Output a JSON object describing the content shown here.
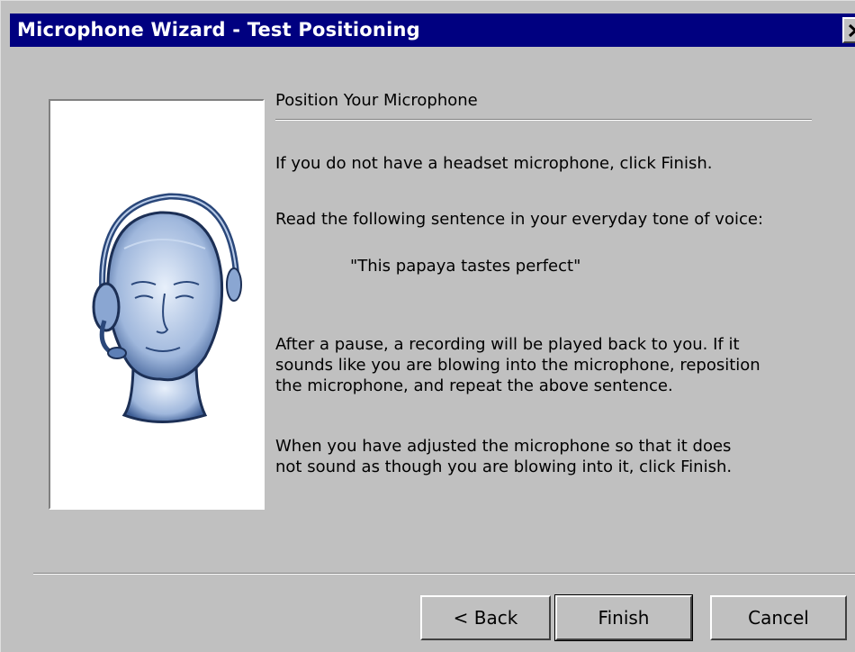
{
  "window": {
    "title": "Microphone Wizard - Test Positioning",
    "title_bar_color": "#000080",
    "close_icon": "close-icon"
  },
  "illustration": {
    "icon": "headset-head-illustration"
  },
  "content": {
    "heading": "Position Your Microphone",
    "line1": "If you do not have a headset microphone, click Finish.",
    "line2": "Read the following sentence in your everyday tone of voice:",
    "sentence": "\"This papaya tastes perfect\"",
    "paragraph3": "After a pause, a recording will be played back to you. If it\nsounds like you are blowing into the microphone, reposition\nthe microphone, and repeat the above sentence.",
    "paragraph4": "When you have adjusted the microphone so that it does\nnot sound as though you are blowing into it, click Finish."
  },
  "buttons": {
    "back": "< Back",
    "finish": "Finish",
    "cancel": "Cancel"
  }
}
